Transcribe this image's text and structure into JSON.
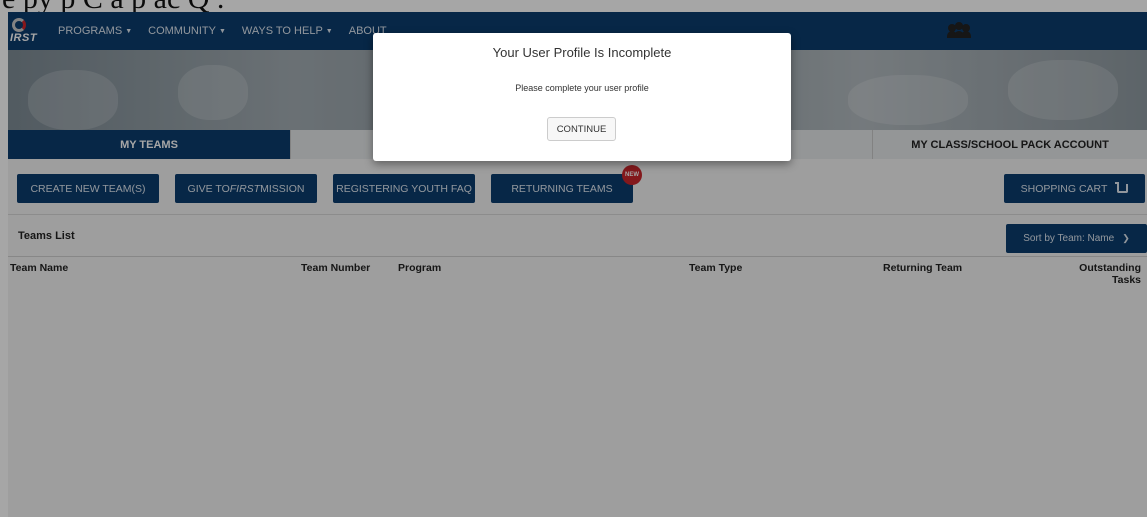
{
  "caption_fragment": "e py p   C   a    p      ac   Q   .",
  "nav": {
    "logo_text": "IRST",
    "items": [
      {
        "label": "PROGRAMS"
      },
      {
        "label": "COMMUNITY"
      },
      {
        "label": "WAYS TO HELP"
      },
      {
        "label": "ABOUT"
      }
    ],
    "user_icon": "people-icon"
  },
  "tabs": [
    {
      "label": "MY TEAMS",
      "active": true
    },
    {
      "label": "",
      "active": false
    },
    {
      "label": "",
      "active": false
    },
    {
      "label": "MY CLASS/SCHOOL PACK ACCOUNT",
      "active": false
    }
  ],
  "actions": {
    "create_team": "CREATE NEW TEAM(S)",
    "give_prefix": "GIVE TO ",
    "give_emph": "FIRST",
    "give_suffix": " MISSION",
    "registering_faq": "REGISTERING YOUTH FAQ",
    "returning_teams": "RETURNING TEAMS",
    "returning_badge": "NEW",
    "shopping_cart": "SHOPPING CART"
  },
  "teams_list": {
    "title": "Teams List",
    "sort_label": "Sort by Team: Name",
    "columns": {
      "team_name": "Team Name",
      "team_number": "Team Number",
      "program": "Program",
      "team_type": "Team Type",
      "returning_team": "Returning Team",
      "outstanding_tasks_1": "Outstanding",
      "outstanding_tasks_2": "Tasks"
    },
    "rows": []
  },
  "modal": {
    "title": "Your User Profile Is Incomplete",
    "body": "Please complete your user profile",
    "button": "CONTINUE"
  },
  "colors": {
    "navy": "#0c3d6e",
    "badge_red": "#c9252b",
    "background": "#f3f3f3"
  }
}
